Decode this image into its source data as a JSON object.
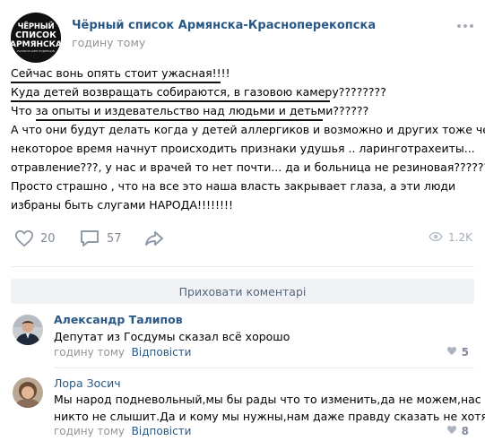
{
  "group": {
    "avatar_lines": [
      "ЧЁРНЫЙ",
      "СПИСОК",
      "АРМЯНСКА",
      "РАЗОБЛАЧАЕМ ПОДЛЕЦОВ"
    ],
    "name": "Чёрный список Армянска-Красноперекопска",
    "time": "годину тому"
  },
  "post": {
    "lines": [
      "Сейчас вонь опять стоит ужасная!!!!",
      "Куда детей возвращать собираются, в газовою камеру????????",
      "Что за опыты и издевательство над людьми и детьми??????",
      "А что они будут делать когда у детей аллергиков и возможно и других тоже через",
      "некоторое время начнут происходить признаки удушья .. ларинготрахеиты...",
      "отравление???, у нас и врачей то нет почти... да и больница не резиновая???????",
      "Просто страшно , что на все это наша власть закрывает глаза, а эти люди",
      "избраны быть слугами НАРОДА!!!!!!!!"
    ]
  },
  "actions": {
    "likes": "20",
    "comments": "57",
    "views": "1.2K"
  },
  "hide_comments_label": "Приховати коментарі",
  "comments": [
    {
      "author": "Александр Талипов",
      "lines": [
        "Депутат из Госдумы сказал всё хорошо"
      ],
      "time": "годину тому",
      "reply": "Відповісти",
      "likes": "5"
    },
    {
      "author": "Лора Зосич",
      "lines": [
        "Мы народ подневольный,мы бы рады что то изменить,да не можем,нас",
        "никто не слышит.Да и кому мы нужны,нам даже правду сказать не хотят."
      ],
      "time": "годину тому",
      "reply": "Відповісти",
      "likes": "8"
    }
  ],
  "colors": {
    "link": "#2a5885",
    "muted": "#939393",
    "icon": "#a8adb3",
    "button_bg": "#f0f2f5"
  },
  "icons": [
    "heart-icon",
    "comment-icon",
    "share-icon",
    "eye-icon",
    "more-icon"
  ]
}
